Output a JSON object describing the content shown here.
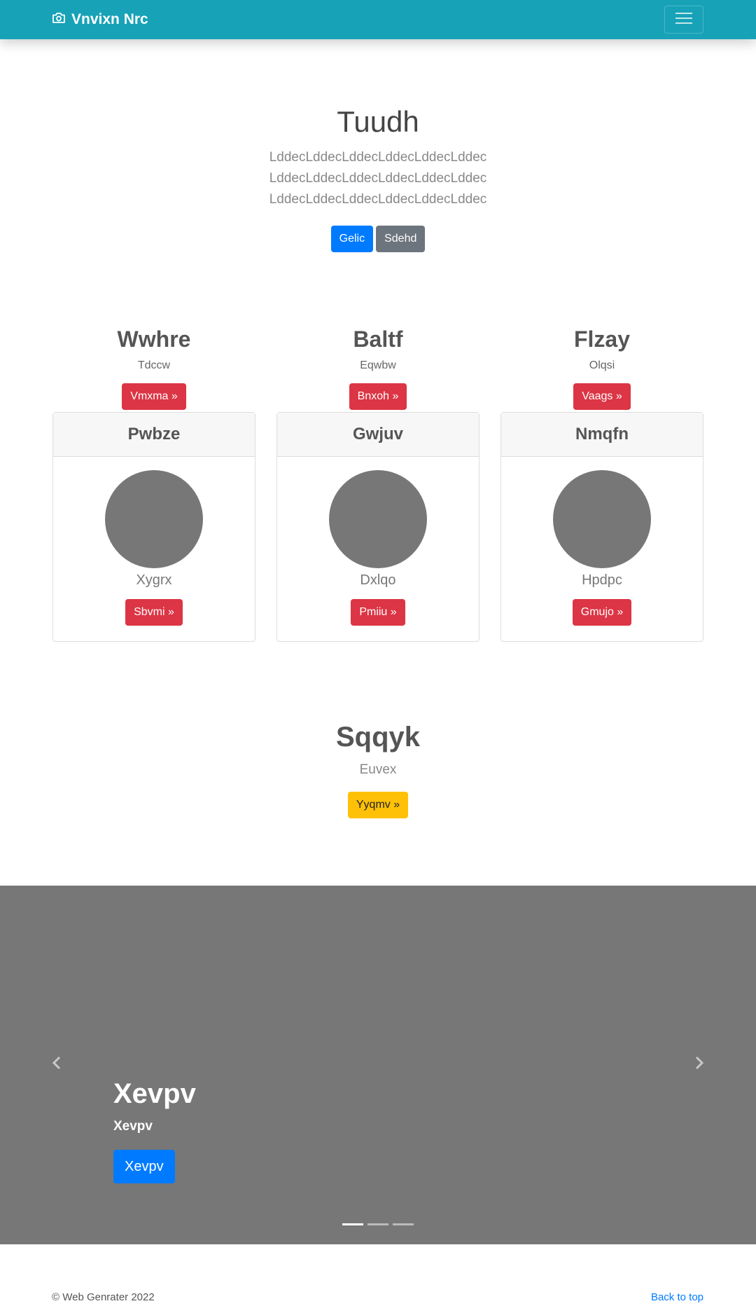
{
  "navbar": {
    "brand": "Vnvixn Nrc",
    "brand_icon": "camera-icon",
    "toggler_icon": "hamburger-menu-icon"
  },
  "hero": {
    "title": "Tuudh",
    "lines": [
      "LddecLddecLddecLddecLddecLddec",
      "LddecLddecLddecLddecLddecLddec",
      "LddecLddecLddecLddecLddecLddec"
    ],
    "primary_button": "Gelic",
    "secondary_button": "Sdehd"
  },
  "columns": [
    {
      "title": "Wwhre",
      "subtitle": "Tdccw",
      "button": "Vmxma »"
    },
    {
      "title": "Baltf",
      "subtitle": "Eqwbw",
      "button": "Bnxoh »"
    },
    {
      "title": "Flzay",
      "subtitle": "Olqsi",
      "button": "Vaags »"
    }
  ],
  "cards": [
    {
      "header": "Pwbze",
      "name": "Xygrx",
      "button": "Sbvmi »"
    },
    {
      "header": "Gwjuv",
      "name": "Dxlqo",
      "button": "Pmiiu »"
    },
    {
      "header": "Nmqfn",
      "name": "Hpdpc",
      "button": "Gmujo »"
    }
  ],
  "feature": {
    "title": "Sqqyk",
    "subtitle": "Euvex",
    "button": "Yyqmv »"
  },
  "carousel": {
    "title": "Xevpv",
    "subtitle": "Xevpv",
    "button": "Xevpv",
    "prev_icon": "chevron-left-icon",
    "next_icon": "chevron-right-icon",
    "slide_count": 3,
    "active_index": 0
  },
  "footer": {
    "copyright": "© Web Genrater 2022",
    "back_to_top": "Back to top"
  },
  "colors": {
    "navbar": "#17a2b8",
    "primary": "#007bff",
    "secondary": "#6c757d",
    "danger": "#dc3545",
    "warning": "#ffc107",
    "placeholder": "#777777"
  }
}
